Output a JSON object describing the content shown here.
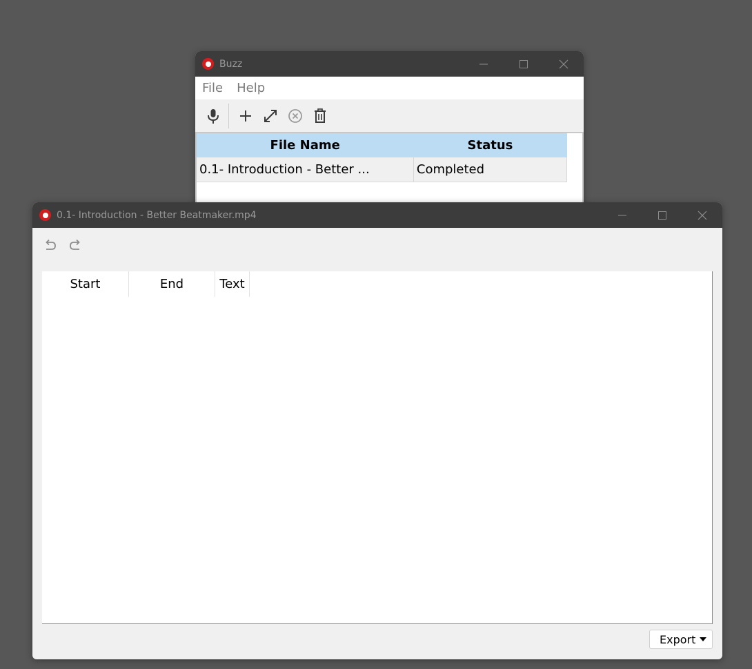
{
  "main_window": {
    "title": "Buzz",
    "menu": [
      "File",
      "Help"
    ],
    "toolbar_icons": [
      "microphone-icon",
      "plus-icon",
      "expand-icon",
      "cancel-icon",
      "trash-icon"
    ],
    "table": {
      "headers": [
        "File Name",
        "Status"
      ],
      "rows": [
        {
          "file_name": "0.1- Introduction - Better ...",
          "status": "Completed"
        }
      ]
    }
  },
  "transcript_window": {
    "title": "0.1- Introduction - Better Beatmaker.mp4",
    "toolbar_icons": [
      "undo-icon",
      "redo-icon"
    ],
    "columns": [
      "Start",
      "End",
      "Text"
    ],
    "export_label": "Export"
  },
  "colors": {
    "desktop": "#575757",
    "titlebar": "#3c3c3c",
    "table_header": "#bcdcf4",
    "app_icon": "#d21e1e"
  }
}
